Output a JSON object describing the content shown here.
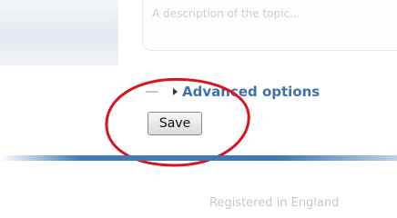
{
  "description": {
    "placeholder": "A description of the topic..."
  },
  "advanced_options": {
    "label": "Advanced options"
  },
  "form": {
    "save_label": "Save"
  },
  "annotation": {
    "color": "#d9141a"
  },
  "accent_color": "#3d72ad",
  "footer": {
    "text": "Registered in England"
  }
}
